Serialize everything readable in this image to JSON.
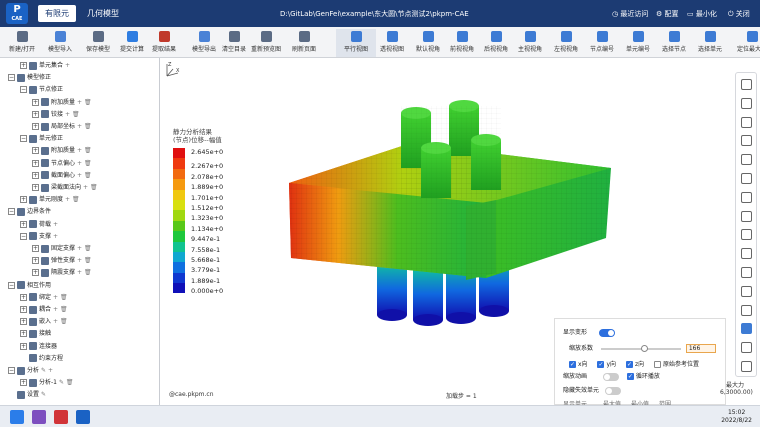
{
  "app": {
    "logo_text": "P",
    "logo_sub": "CAE",
    "tabs": [
      "有限元",
      "几何模型"
    ],
    "doc_title": "D:\\GitLab\\GenFei\\example\\东大圆\\节点测试2\\pkpm-CAE"
  },
  "window_buttons": {
    "recent": "最近访问",
    "settings": "配置",
    "minimize": "最小化",
    "close": "关闭"
  },
  "toolbar": [
    {
      "label": "新建/打开",
      "color": "#5b6b84"
    },
    {
      "label": "模型导入",
      "color": "#4a82d6"
    },
    {
      "label": "保存模型",
      "color": "#5b6b84"
    },
    {
      "label": "提交计算",
      "color": "#2e7de1"
    },
    {
      "label": "提取结果",
      "color": "#c0392b"
    },
    {
      "label": "模型导出",
      "color": "#4a82d6"
    },
    {
      "label": "清空目录",
      "color": "#5b6b84"
    },
    {
      "label": "重新预览图",
      "color": "#5b6b84"
    },
    {
      "label": "刷新页面",
      "color": "#5b6b84"
    },
    {
      "label": "平行视图",
      "color": "#3d7bd4"
    },
    {
      "label": "透视视图",
      "color": "#3d7bd4"
    },
    {
      "label": "默认视角",
      "color": "#3d7bd4"
    },
    {
      "label": "前视视角",
      "color": "#3d7bd4"
    },
    {
      "label": "后视视角",
      "color": "#3d7bd4"
    },
    {
      "label": "主视视角",
      "color": "#3d7bd4"
    },
    {
      "label": "左视视角",
      "color": "#3d7bd4"
    },
    {
      "label": "节点编号",
      "color": "#3d7bd4"
    },
    {
      "label": "单元编号",
      "color": "#3d7bd4"
    },
    {
      "label": "选择节点",
      "color": "#3d7bd4"
    },
    {
      "label": "选择单元",
      "color": "#3d7bd4"
    },
    {
      "label": "定位最大值",
      "color": "#3d7bd4"
    }
  ],
  "tree": [
    {
      "label": "单元集合",
      "level": 2,
      "box": "+",
      "extra": "+"
    },
    {
      "label": "模型修正",
      "level": 1,
      "box": "-",
      "extra": ""
    },
    {
      "label": "节点修正",
      "level": 2,
      "box": "-",
      "extra": ""
    },
    {
      "label": "附加质量",
      "level": 3,
      "box": "+",
      "extra": "+ 🗑"
    },
    {
      "label": "铰接",
      "level": 3,
      "box": "+",
      "extra": "+ 🗑"
    },
    {
      "label": "局部坐标",
      "level": 3,
      "box": "+",
      "extra": "+ 🗑"
    },
    {
      "label": "单元修正",
      "level": 2,
      "box": "-",
      "extra": ""
    },
    {
      "label": "附加质量",
      "level": 3,
      "box": "+",
      "extra": "+ 🗑"
    },
    {
      "label": "节点偏心",
      "level": 3,
      "box": "+",
      "extra": "+ 🗑"
    },
    {
      "label": "截面偏心",
      "level": 3,
      "box": "+",
      "extra": "+ 🗑"
    },
    {
      "label": "梁截面法向",
      "level": 3,
      "box": "+",
      "extra": "+ 🗑"
    },
    {
      "label": "单元刚度",
      "level": 2,
      "box": "+",
      "extra": "+ 🗑"
    },
    {
      "label": "边界条件",
      "level": 1,
      "box": "-",
      "extra": ""
    },
    {
      "label": "荷载",
      "level": 2,
      "box": "+",
      "extra": "+"
    },
    {
      "label": "支撑",
      "level": 2,
      "box": "-",
      "extra": "+"
    },
    {
      "label": "固定支撑",
      "level": 3,
      "box": "+",
      "extra": "+ 🗑"
    },
    {
      "label": "弹性支撑",
      "level": 3,
      "box": "+",
      "extra": "+ 🗑"
    },
    {
      "label": "隔震支撑",
      "level": 3,
      "box": "+",
      "extra": "+ 🗑"
    },
    {
      "label": "相互作用",
      "level": 1,
      "box": "-",
      "extra": ""
    },
    {
      "label": "绑定",
      "level": 2,
      "box": "+",
      "extra": "+ 🗑"
    },
    {
      "label": "耦合",
      "level": 2,
      "box": "+",
      "extra": "+ 🗑"
    },
    {
      "label": "嵌入",
      "level": 2,
      "box": "+",
      "extra": "+ 🗑"
    },
    {
      "label": "接触",
      "level": 2,
      "box": "+",
      "extra": ""
    },
    {
      "label": "连接器",
      "level": 2,
      "box": "+",
      "extra": ""
    },
    {
      "label": "约束方程",
      "level": 2,
      "box": "",
      "extra": ""
    },
    {
      "label": "分析",
      "level": 1,
      "box": "-",
      "extra": "✎ +"
    },
    {
      "label": "分析-1",
      "level": 2,
      "box": "+",
      "extra": "✎ 🗑"
    },
    {
      "label": "设置",
      "level": 1,
      "box": "",
      "extra": "✎"
    }
  ],
  "legend": {
    "title_line1": "静力分析结果",
    "title_line2": "(节点)位移--幅值",
    "values": [
      "2.645e+0",
      "2.267e+0",
      "2.078e+0",
      "1.889e+0",
      "1.701e+0",
      "1.512e+0",
      "1.323e+0",
      "1.134e+0",
      "9.447e-1",
      "7.558e-1",
      "5.668e-1",
      "3.779e-1",
      "1.889e-1",
      "0.000e+0"
    ],
    "colors": [
      "#e01010",
      "#ef3a10",
      "#f26a10",
      "#f59a10",
      "#f0c810",
      "#d8e010",
      "#a0d810",
      "#58c818",
      "#1ec83c",
      "#10c490",
      "#10a8d0",
      "#1070e0",
      "#1038d0",
      "#1010b8"
    ]
  },
  "viewport": {
    "axis_label": "Z  X  Y",
    "site": "@cae.pkpm.cn",
    "step_label": "加载步 = 1"
  },
  "display_panel": {
    "show_deform_label": "显示变形",
    "scale_label": "缩放系数",
    "scale_value": "166",
    "dir_x": "x向",
    "dir_y": "y向",
    "dir_z": "z向",
    "orig_ref": "原始参考位置",
    "zoom_anim": "缩放动画",
    "loop_play": "循环播放",
    "hide_fail": "隐藏失效单元",
    "bottom_row": [
      "显示单元",
      "最大值",
      "最小值",
      "范围"
    ]
  },
  "side_labels": {
    "line1": "最大力",
    "line2": "6,3000.00)"
  },
  "clock": {
    "time": "15:02",
    "date": "2022/8/22"
  }
}
